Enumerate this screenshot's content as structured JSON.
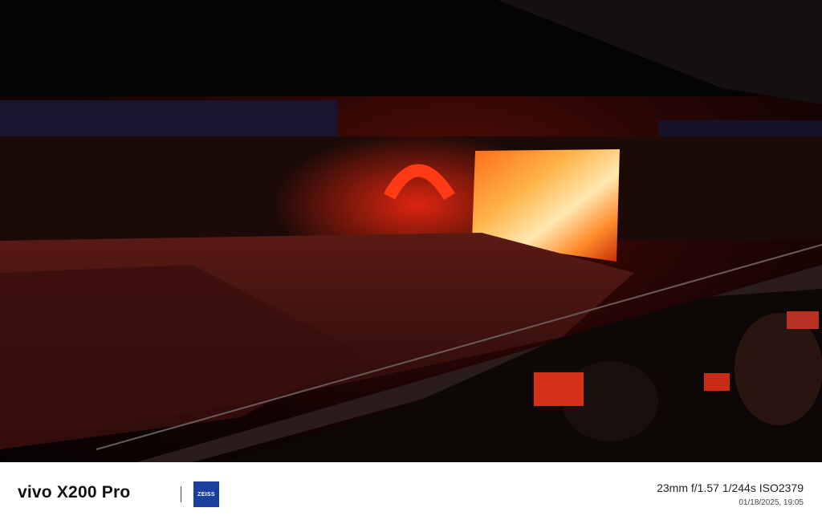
{
  "photo": {
    "subject": "stadium-concert"
  },
  "footer": {
    "brand": "vivo X200 Pro",
    "logo_text": "ZEISS",
    "specs": "23mm  f/1.57  1/244s  ISO2379",
    "datetime": "01/18/2025, 19:05"
  }
}
